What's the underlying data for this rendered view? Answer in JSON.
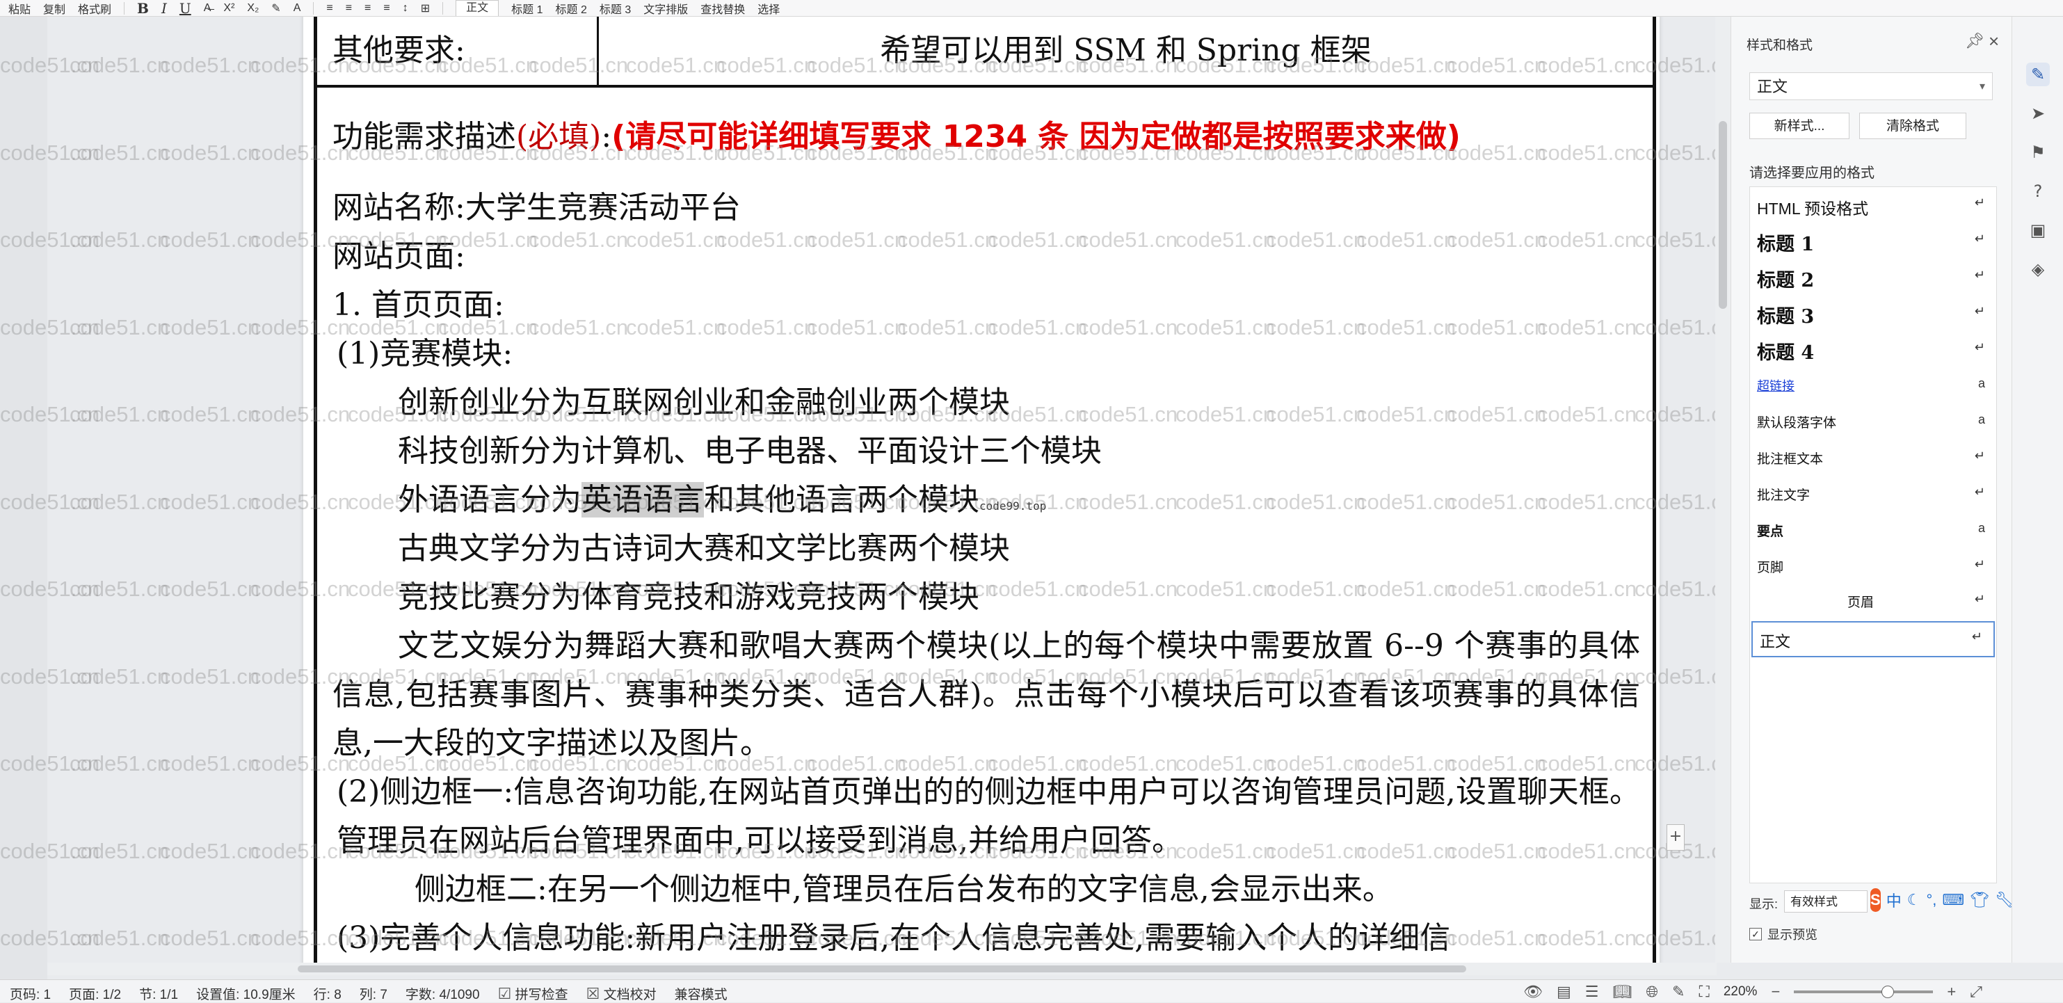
{
  "toolbar": {
    "paste": "粘贴",
    "copy": "复制",
    "format_painter": "格式刷",
    "style_chips": [
      "正文",
      "标题 1",
      "标题 2",
      "标题 3"
    ],
    "text_layout": "文字排版",
    "find_replace": "查找替换",
    "select": "选择"
  },
  "document": {
    "other_req_label": "其他要求:",
    "other_req_value": "希望可以用到 SSM 和 Spring 框架",
    "func_label": "功能需求描述",
    "func_required": "(必填)",
    "func_colon": ":",
    "func_note": "(请尽可能详细填写要求 1234 条 因为定做都是按照要求来做)",
    "site_name": "网站名称:大学生竞赛活动平台",
    "site_pages": "网站页面:",
    "home_page": "1.  首页页面:",
    "module_heading": "(1)竞赛模块:",
    "line_innovation": "创新创业分为互联网创业和金融创业两个模块",
    "line_tech": "科技创新分为计算机、电子电器、平面设计三个模块",
    "line_lang_pre": "外语语言分为",
    "line_lang_sel": "英语语言",
    "line_lang_post": "和其他语言两个模块",
    "overlay_link": "code99.top",
    "line_classic": "古典文学分为古诗词大赛和文学比赛两个模块",
    "line_sports": "竞技比赛分为体育竞技和游戏竞技两个模块",
    "para_arts": "文艺文娱分为舞蹈大赛和歌唱大赛两个模块(以上的每个模块中需要放置 6--9 个赛事的具体信息,包括赛事图片、赛事种类分类、适合人群)。点击每个小模块后可以查看该项赛事的具体信息,一大段的文字描述以及图片。",
    "para_sidebar1": "(2)侧边框一:信息咨询功能,在网站首页弹出的的侧边框中用户可以咨询管理员问题,设置聊天框。管理员在网站后台管理界面中,可以接受到消息,并给用户回答。",
    "para_sidebar2": "侧边框二:在另一个侧边框中,管理员在后台发布的文字信息,会显示出来。",
    "para_profile": "(3)完善个人信息功能:新用户注册登录后,在个人信息完善处,需要输入个人的详细信"
  },
  "watermark_text": "code51.cn",
  "style_pane": {
    "title": "样式和格式",
    "current_style": "正文",
    "new_style": "新样式...",
    "clear_format": "清除格式",
    "apply_caption": "请选择要应用的格式",
    "styles": [
      {
        "label": "HTML  预设格式",
        "mark": "↵"
      },
      {
        "label": "标题  1",
        "mark": "↵"
      },
      {
        "label": "标题  2",
        "mark": "↵"
      },
      {
        "label": "标题  3",
        "mark": "↵"
      },
      {
        "label": "标题  4",
        "mark": "↵"
      },
      {
        "label": "超链接",
        "mark": "a"
      },
      {
        "label": "默认段落字体",
        "mark": "a"
      },
      {
        "label": "批注框文本",
        "mark": "↵"
      },
      {
        "label": "批注文字",
        "mark": "↵"
      },
      {
        "label": "要点",
        "mark": "a"
      },
      {
        "label": "页脚",
        "mark": "↵"
      },
      {
        "label": "页眉",
        "mark": "↵"
      },
      {
        "label": "正文",
        "mark": "↵"
      }
    ],
    "show_label": "显示:",
    "show_value": "有效样式",
    "ime_text": "中",
    "preview_label": "显示预览"
  },
  "statusbar": {
    "page_no": "页码: 1",
    "page": "页面: 1/2",
    "section": "节: 1/1",
    "setting": "设置值: 10.9厘米",
    "row": "行: 8",
    "col": "列: 7",
    "wordcount": "字数: 4/1090",
    "spellcheck": "拼写检查",
    "proofread": "文档校对",
    "compat": "兼容模式",
    "zoom": "220%"
  }
}
